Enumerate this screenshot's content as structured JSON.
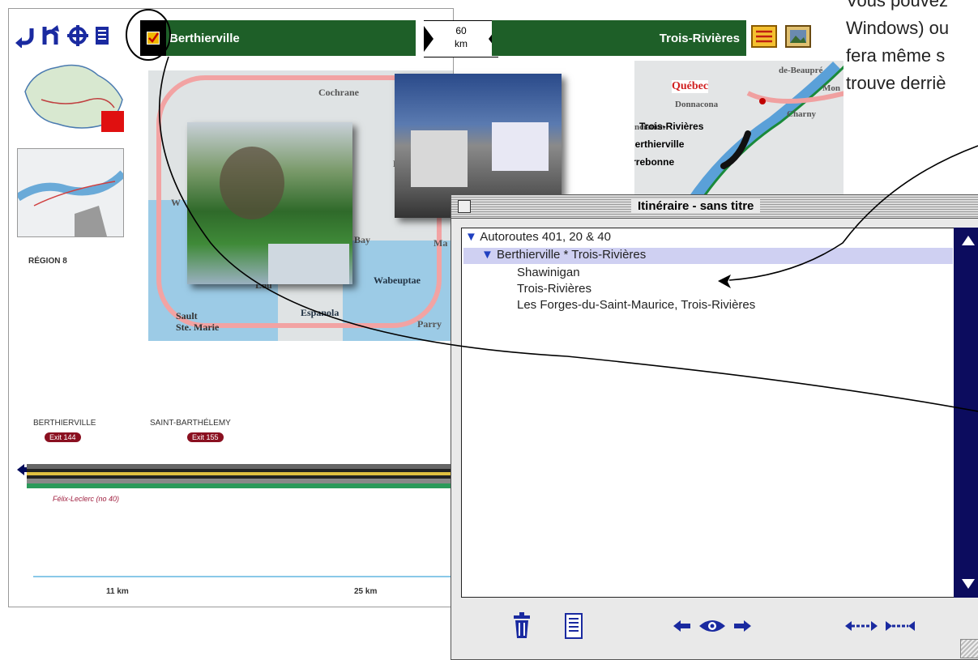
{
  "toolbar": {
    "icons": [
      "back-icon",
      "route-icon",
      "locate-icon",
      "book-icon"
    ],
    "checkbox": "checked",
    "origin": "Berthierville",
    "distance": "60\nkm",
    "destination": "Trois-Rivières",
    "right_icons": [
      "notes-icon",
      "photos-icon"
    ]
  },
  "overview": {
    "region_label": "RÉGION 8"
  },
  "map_labels": {
    "cochrane": "Cochrane",
    "quebec": "Québec",
    "de_beaupre": "de-Beaupré",
    "mon": "Mon",
    "donnacona": "Donnacona",
    "charny": "Charny",
    "nciation": "nciation",
    "trois_rivieres": "Trois-Rivières",
    "berthierville": "Berthierville",
    "terrebonne": "Terrebonne",
    "w": "W",
    "bay": "Bay",
    "ma": "Ma",
    "k": "K",
    "wabeuptae": "Wabeuptae",
    "el": "El",
    "lou": "Lou",
    "sault": "Sault\nSte. Marie",
    "espanola": "Espanola",
    "parry": "Parry"
  },
  "strip": {
    "town1": "BERTHIERVILLE",
    "exit1": "Exit 144",
    "town2": "SAINT-BARTHÉLEMY",
    "exit2": "Exit 155",
    "road_name": "Félix-Leclerc  (no 40)",
    "km1": "11 km",
    "km2": "25 km"
  },
  "itinerary_window": {
    "title": "Itinéraire - sans titre",
    "group": "Autoroutes 401, 20 & 40",
    "segment": "Berthierville  *  Trois-Rivières",
    "stops": [
      "Shawinigan",
      "Trois-Rivières",
      "Les Forges-du-Saint-Maurice, Trois-Rivières"
    ],
    "bottom_icons": [
      "trash-icon",
      "document-icon",
      "prev-icon",
      "eye-icon",
      "next-icon",
      "collapse-icon",
      "expand-icon"
    ]
  },
  "note_text": "Vous pouvez\nWindows) ou\nfera même s\ntrouve derriè",
  "colors": {
    "route_green": "#1e5f28",
    "scroll_navy": "#0c0c5e",
    "selection": "#cfd0f2",
    "exit_red": "#8a1020"
  }
}
